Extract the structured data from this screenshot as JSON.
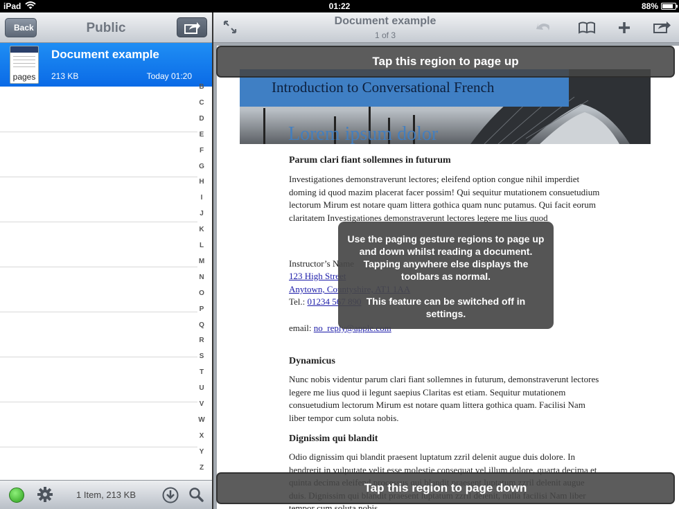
{
  "status_bar": {
    "device": "iPad",
    "time": "01:22",
    "battery": "88%"
  },
  "left_panel": {
    "back_label": "Back",
    "title": "Public",
    "document": {
      "name": "Document example",
      "size": "213 KB",
      "date": "Today 01:20",
      "thumb_label": "pages"
    },
    "index_letters": [
      "B",
      "C",
      "D",
      "E",
      "F",
      "G",
      "H",
      "I",
      "J",
      "K",
      "L",
      "M",
      "N",
      "O",
      "P",
      "Q",
      "R",
      "S",
      "T",
      "U",
      "V",
      "W",
      "X",
      "Y",
      "Z"
    ],
    "footer_count": "1 Item, 213 KB"
  },
  "right_panel": {
    "doc_title": "Document example",
    "page_count": "1 of 3",
    "page_up_text": "Tap this region to page up",
    "page_down_text": "Tap this region to page down",
    "hint_line1": "Use the paging gesture regions to page up and down whilst reading a document. Tapping anywhere else displays the toolbars as normal.",
    "hint_line2": "This feature can be switched off in settings."
  },
  "document_page": {
    "banner_title": "Introduction to Conversational French",
    "banner_ghost": "Lorem ipsum dolor",
    "h1": "Parum clari fiant sollemnes in futurum",
    "p1": "Investigationes demonstraverunt lectores; eleifend option congue nihil imperdiet doming id quod mazim placerat facer possim! Qui sequitur mutationem consuetudium lectorum Mirum est notare quam littera gothica quam nunc putamus. Qui facit eorum claritatem Investigationes demonstraverunt lectores legere me lius quod",
    "instructor": "Instructor’s Name",
    "street": "123 High Street",
    "town": "Anytown, Countyshire, AT1 1AA",
    "tel_label": "Tel.: ",
    "tel": "01234 567 890",
    "email_label": "email: ",
    "email": "no_reply@apple.com",
    "h2": "Dynamicus",
    "p2": "Nunc nobis videntur parum clari fiant sollemnes in futurum, demonstraverunt lectores legere me lius quod ii legunt saepius Claritas est etiam. Sequitur mutationem consuetudium lectorum Mirum est notare quam littera gothica quam. Facilisi Nam liber tempor cum soluta nobis.",
    "h3": "Dignissim qui blandit",
    "p3": "Odio dignissim qui blandit praesent luptatum zzril delenit augue duis dolore. In hendrerit in vulputate velit esse molestie consequat vel illum dolore, quarta decima et quinta decima eleifend processus qui blandit praesent luptatum zzril delenit augue duis. Dignissim qui blandit praesent luptatum zzril delenit, nulla facilisi Nam liber tempor cum soluta nobis"
  }
}
